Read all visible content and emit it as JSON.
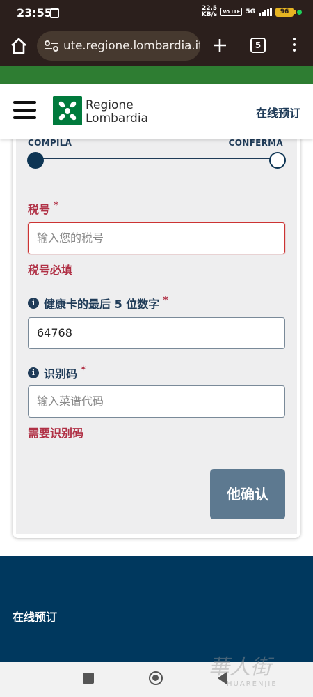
{
  "status_bar": {
    "time": "23:55",
    "net_speed_value": "22.5",
    "net_speed_unit": "KB/s",
    "volte_label": "Vo LTE",
    "network_label": "5G",
    "battery_level": "96"
  },
  "browser": {
    "url": "ute.regione.lombardia.it",
    "tab_count": "5"
  },
  "header": {
    "logo_line1": "Regione",
    "logo_line2": "Lombardia",
    "book_link": "在线预订"
  },
  "stepper": {
    "left_label": "COMPILA",
    "right_label": "CONFERMA"
  },
  "form": {
    "tax_code": {
      "label": "税号",
      "required_mark": "*",
      "placeholder": "输入您的税号",
      "value": "",
      "error": "税号必填"
    },
    "health_card": {
      "label": "健康卡的最后 5 位数字",
      "required_mark": "*",
      "value": "64768"
    },
    "id_code": {
      "label": "识别码",
      "required_mark": "*",
      "placeholder": "输入菜谱代码",
      "value": "",
      "error": "需要识别码"
    },
    "confirm_button": "他确认"
  },
  "footer": {
    "link": "在线预订"
  },
  "watermark": {
    "main": "華人街",
    "sub": "HUARENJIE"
  },
  "colors": {
    "status_bg": "#2b1f1c",
    "green_strip": "#2e7d32",
    "brand_navy": "#1f3b58",
    "error_red": "#b03045",
    "button_bg": "#5d7990",
    "footer_bg": "#00385e"
  }
}
